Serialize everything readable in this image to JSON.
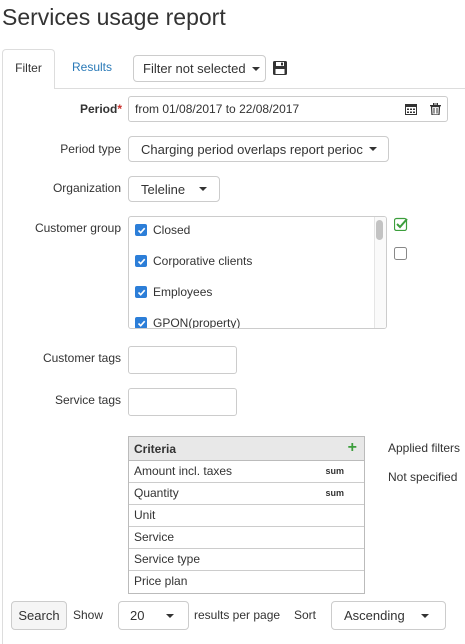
{
  "page": {
    "title": "Services usage report"
  },
  "tabs": {
    "filter": "Filter",
    "results": "Results"
  },
  "filter_select": {
    "value": "Filter not selected"
  },
  "form": {
    "period": {
      "label": "Period",
      "required_mark": "*",
      "value": "from 01/08/2017 to 22/08/2017"
    },
    "period_type": {
      "label": "Period type",
      "value": "Charging period overlaps report perioc"
    },
    "organization": {
      "label": "Organization",
      "value": "Teleline"
    },
    "customer_group": {
      "label": "Customer group",
      "items": [
        {
          "label": "Closed",
          "checked": true
        },
        {
          "label": "Corporative clients",
          "checked": true
        },
        {
          "label": "Employees",
          "checked": true
        },
        {
          "label": "GPON(property)",
          "checked": true
        }
      ]
    },
    "customer_tags": {
      "label": "Customer tags",
      "value": ""
    },
    "service_tags": {
      "label": "Service tags",
      "value": ""
    }
  },
  "criteria": {
    "header": "Criteria",
    "rows": [
      {
        "label": "Amount incl. taxes",
        "agg": "sum"
      },
      {
        "label": "Quantity",
        "agg": "sum"
      },
      {
        "label": "Unit",
        "agg": ""
      },
      {
        "label": "Service",
        "agg": ""
      },
      {
        "label": "Service type",
        "agg": ""
      },
      {
        "label": "Price plan",
        "agg": ""
      }
    ]
  },
  "applied_filters": {
    "label": "Applied filters",
    "value": "Not specified"
  },
  "footer": {
    "search": "Search",
    "show_label": "Show",
    "per_page": "20",
    "per_page_suffix": "results per page",
    "sort_label": "Sort",
    "sort_value": "Ascending"
  },
  "colors": {
    "accent": "#2c7ed8",
    "link": "#2a7ab8",
    "required": "#c9302c",
    "add": "#3c9e3c"
  },
  "icons": [
    "save-icon",
    "calendar-icon",
    "trash-icon",
    "checkbox-checked-icon",
    "checkbox-icon",
    "plus-icon",
    "caret-down-icon"
  ]
}
